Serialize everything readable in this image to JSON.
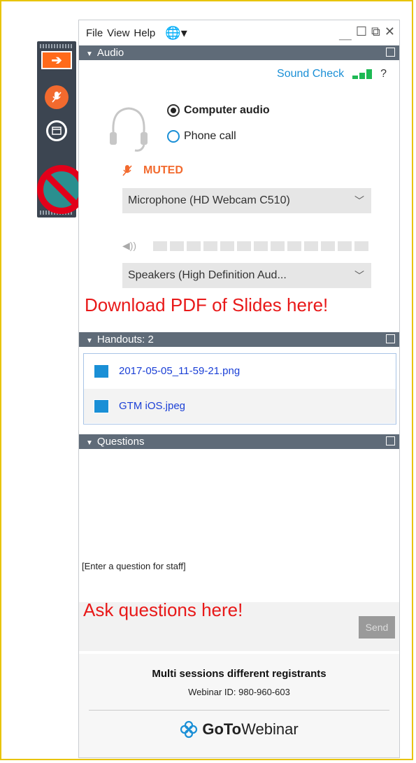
{
  "menu": {
    "file": "File",
    "view": "View",
    "help": "Help"
  },
  "audio": {
    "header": "Audio",
    "sound_check": "Sound Check",
    "help_mark": "?",
    "options": [
      {
        "label": "Computer audio",
        "selected": true
      },
      {
        "label": "Phone call",
        "selected": false
      }
    ],
    "muted_label": "MUTED",
    "microphone": "Microphone (HD Webcam C510)",
    "speakers": "Speakers (High Definition Aud..."
  },
  "annotation_download": "Download PDF of Slides here!",
  "handouts": {
    "header": "Handouts: 2",
    "items": [
      "2017-05-05_11-59-21.png",
      "GTM iOS.jpeg"
    ]
  },
  "questions": {
    "header": "Questions",
    "placeholder": "[Enter a question for staff]",
    "send_label": "Send"
  },
  "annotation_ask": "Ask questions here!",
  "footer": {
    "session_title": "Multi sessions different registrants",
    "webinar_id": "Webinar ID: 980-960-603",
    "brand_bold": "GoTo",
    "brand_regular": "Webinar"
  },
  "colors": {
    "accent_orange": "#f26a2e",
    "link_blue": "#1a8fd6",
    "header_gray": "#5f6b78",
    "annotation_red": "#e81919"
  }
}
